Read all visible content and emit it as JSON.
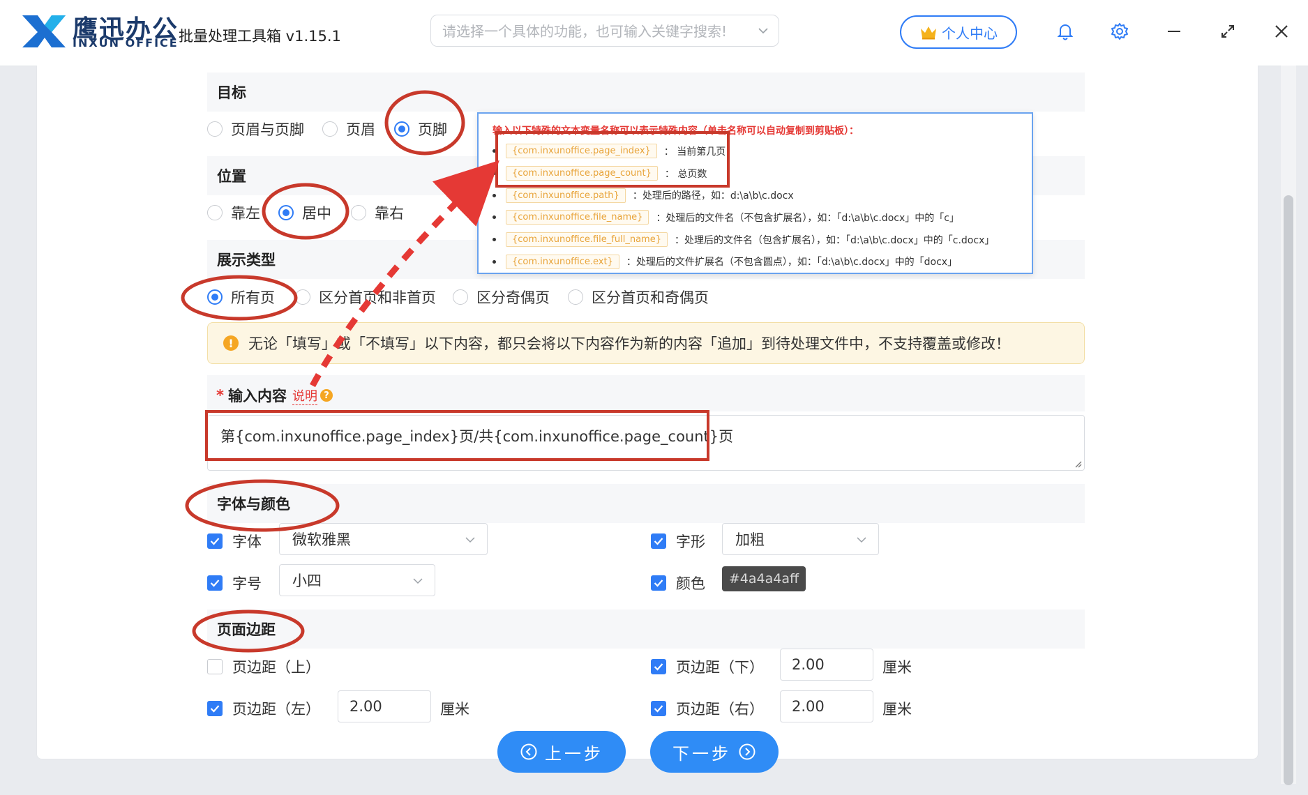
{
  "app": {
    "brand_cn": "鹰迅办公",
    "brand_en": "INXUN OFFICE",
    "title": "批量处理工具箱 v1.15.1",
    "search_placeholder": "请选择一个具体的功能，也可输入关键字搜索!",
    "user_center": "个人中心",
    "accent_color": "#2f7cf6"
  },
  "target": {
    "heading": "目标",
    "options": [
      "页眉与页脚",
      "页眉",
      "页脚"
    ],
    "selected": "页脚"
  },
  "position": {
    "heading": "位置",
    "options": [
      "靠左",
      "居中",
      "靠右"
    ],
    "selected": "居中"
  },
  "display_type": {
    "heading": "展示类型",
    "options": [
      "所有页",
      "区分首页和非首页",
      "区分奇偶页",
      "区分首页和奇偶页"
    ],
    "selected": "所有页"
  },
  "notice": "无论「填写」或「不填写」以下内容，都只会将以下内容作为新的内容「追加」到待处理文件中，不支持覆盖或修改！",
  "content": {
    "label": "输入内容",
    "required_mark": "*",
    "help_link": "说明",
    "value": "第{com.inxunoffice.page_index}页/共{com.inxunoffice.page_count}页"
  },
  "tooltip": {
    "heading": "输入以下特殊的文本变量名称可以表示特殊内容（单击名称可以自动复制到剪贴板）：",
    "items": [
      {
        "var": "{com.inxunoffice.page_index}",
        "desc": "：  当前第几页"
      },
      {
        "var": "{com.inxunoffice.page_count}",
        "desc": "：  总页数"
      },
      {
        "var": "{com.inxunoffice.path}",
        "desc": "：处理后的路径，如：d:\\a\\b\\c.docx"
      },
      {
        "var": "{com.inxunoffice.file_name}",
        "desc": "：处理后的文件名（不包含扩展名），如：「d:\\a\\b\\c.docx」中的「c」"
      },
      {
        "var": "{com.inxunoffice.file_full_name}",
        "desc": "：处理后的文件名（包含扩展名），如：「d:\\a\\b\\c.docx」中的「c.docx」"
      },
      {
        "var": "{com.inxunoffice.ext}",
        "desc": "：处理后的文件扩展名（不包含圆点），如：「d:\\a\\b\\c.docx」中的「docx」"
      }
    ]
  },
  "font_color": {
    "heading": "字体与颜色",
    "font_label": "字体",
    "font_value": "微软雅黑",
    "style_label": "字形",
    "style_value": "加粗",
    "size_label": "字号",
    "size_value": "小四",
    "color_label": "颜色",
    "color_value": "#4a4a4aff"
  },
  "margins": {
    "heading": "页面边距",
    "top_label": "页边距（上）",
    "bottom_label": "页边距（下）",
    "bottom_value": "2.00",
    "left_label": "页边距（左）",
    "left_value": "2.00",
    "right_label": "页边距（右）",
    "right_value": "2.00",
    "unit": "厘米"
  },
  "nav": {
    "prev": "上一步",
    "next": "下一步"
  }
}
